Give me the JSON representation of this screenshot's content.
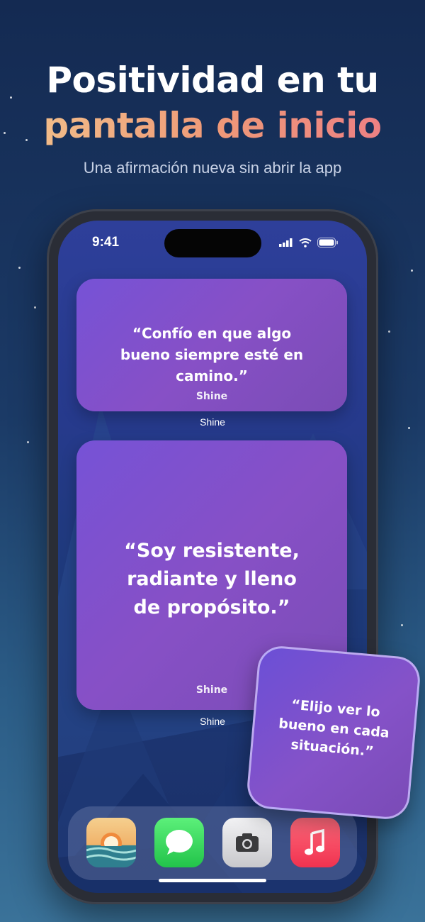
{
  "headline": {
    "line1": "Positividad en tu",
    "line2": "pantalla de inicio",
    "subtitle": "Una afirmación nueva sin abrir la app"
  },
  "status_bar": {
    "time": "9:41"
  },
  "widgets": [
    {
      "quote": "“Confío en que algo bueno siempre esté en camino.”",
      "brand": "Shine",
      "caption": "Shine"
    },
    {
      "quote": "“Soy resistente, radiante y lleno de propósito.”",
      "brand": "Shine",
      "caption": "Shine"
    }
  ],
  "floating_widget": {
    "quote": "“Elijo ver lo bueno en cada situación.”"
  },
  "dock": {
    "apps": [
      {
        "name": "Shine",
        "icon": "sunrise-icon"
      },
      {
        "name": "Messages",
        "icon": "speech-bubble-icon"
      },
      {
        "name": "Camera",
        "icon": "camera-icon"
      },
      {
        "name": "Music",
        "icon": "music-note-icon"
      }
    ]
  },
  "colors": {
    "background_top": "#142a52",
    "widget_purple": "#8750c6",
    "headline_gradient_start": "#f2c48d",
    "headline_gradient_end": "#ec7a86"
  }
}
